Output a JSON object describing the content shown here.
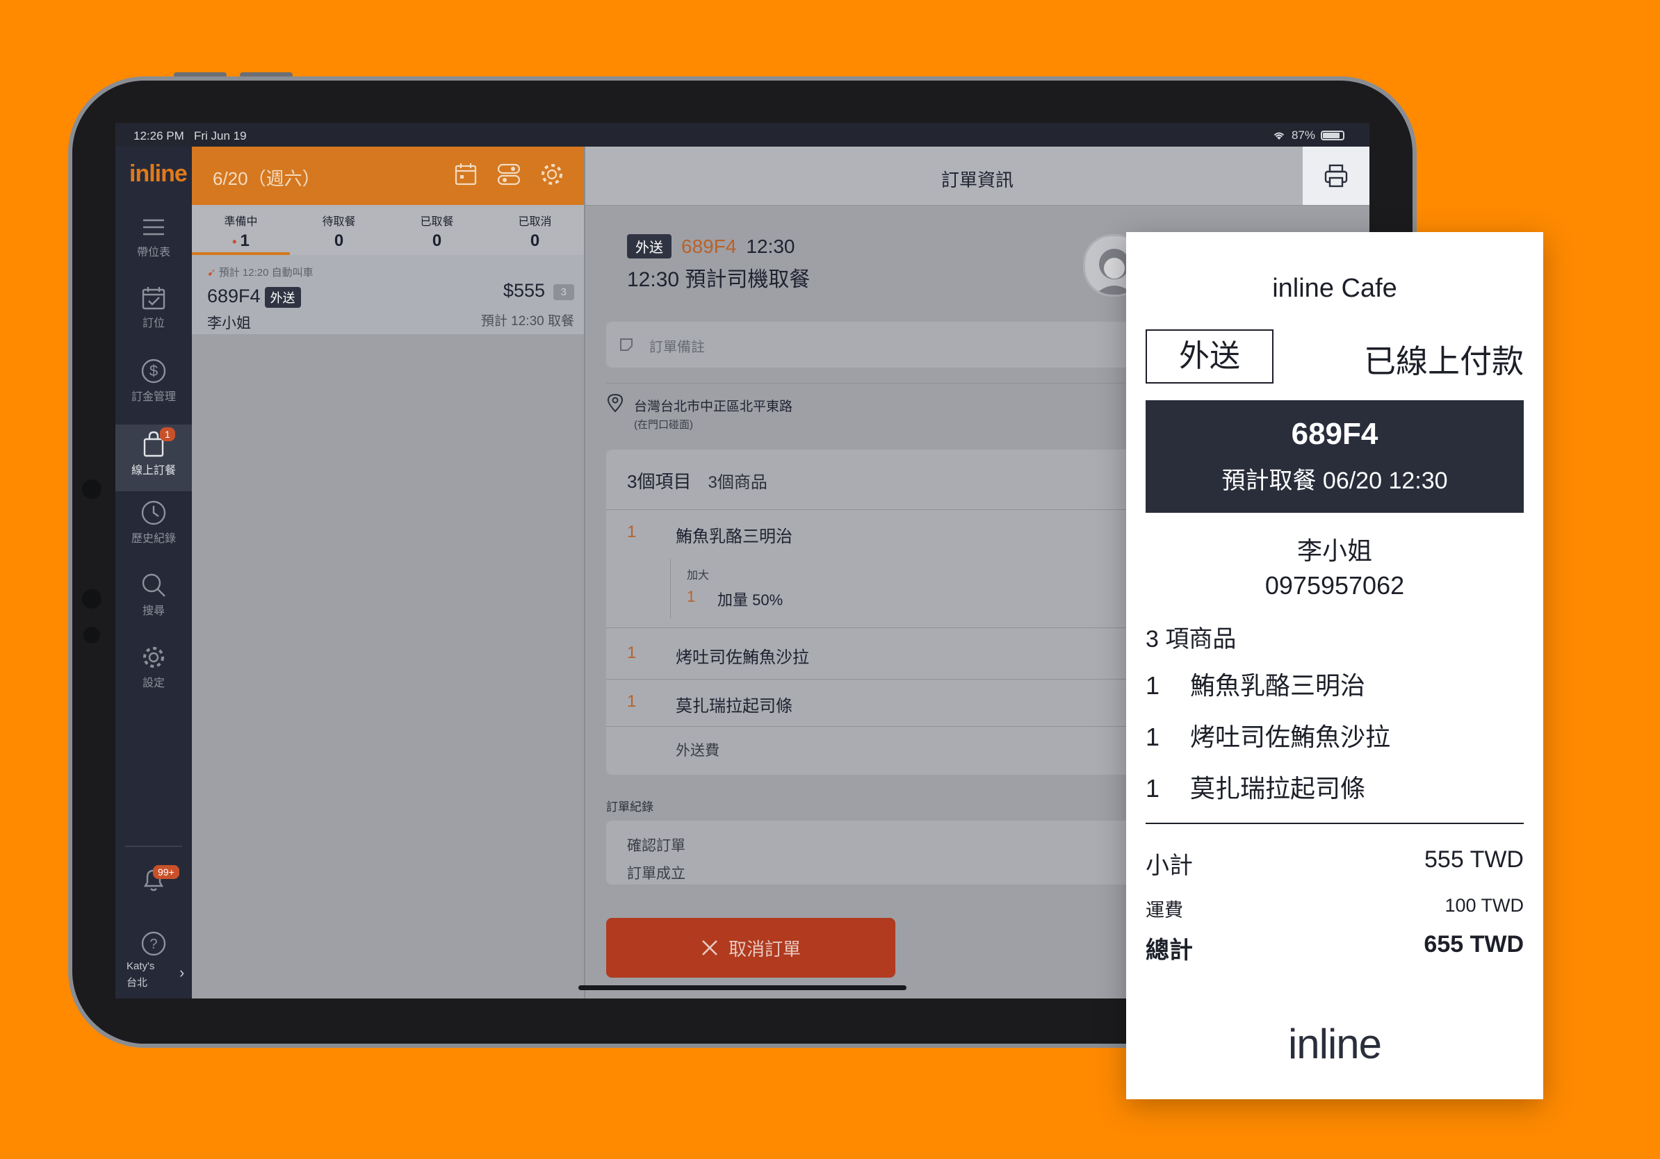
{
  "status": {
    "time": "12:26 PM",
    "date": "Fri Jun 19",
    "battery": "87%"
  },
  "sidebar": {
    "logo": "inline",
    "items": [
      {
        "label": "帶位表",
        "icon": "menu-icon"
      },
      {
        "label": "訂位",
        "icon": "calendar-check-icon"
      },
      {
        "label": "訂金管理",
        "icon": "dollar-icon"
      },
      {
        "label": "線上訂餐",
        "icon": "bag-icon",
        "badge": "1"
      },
      {
        "label": "歷史紀錄",
        "icon": "clock-icon"
      },
      {
        "label": "搜尋",
        "icon": "search-icon"
      },
      {
        "label": "設定",
        "icon": "gear-icon"
      }
    ],
    "notifications_badge": "99+",
    "account_line1": "Katy's",
    "account_line2": "台北"
  },
  "list": {
    "date": "6/20（週六）",
    "tabs": [
      {
        "name": "準備中",
        "value": "1"
      },
      {
        "name": "待取餐",
        "value": "0"
      },
      {
        "name": "已取餐",
        "value": "0"
      },
      {
        "name": "已取消",
        "value": "0"
      }
    ],
    "order": {
      "note": "預計 12:20 自動叫車",
      "code": "689F4",
      "type": "外送",
      "name": "李小姐",
      "price": "$555",
      "qty": "3",
      "eta": "預計 12:30 取餐"
    }
  },
  "detail": {
    "title": "訂單資訊",
    "type": "外送",
    "code": "689F4",
    "time": "12:30",
    "subtitle": "12:30 預計司機取餐",
    "note_placeholder": "訂單備註",
    "address": "台灣台北市中正區北平東路",
    "address_note": "(在門口碰面)",
    "items_header": "3個項目",
    "goods_count": "3個商品",
    "items": [
      {
        "qty": "1",
        "name": "鮪魚乳酪三明治"
      },
      {
        "qty": "1",
        "name": "烤吐司佐鮪魚沙拉"
      },
      {
        "qty": "1",
        "name": "莫扎瑞拉起司條"
      }
    ],
    "option_group": "加大",
    "option_qty": "1",
    "option_name": "加量 50%",
    "delivery_fee_label": "外送費",
    "log_title": "訂單紀錄",
    "log_entries": [
      "確認訂單",
      "訂單成立"
    ],
    "cancel_label": "取消訂單"
  },
  "receipt": {
    "shop": "inline Cafe",
    "type": "外送",
    "payment": "已線上付款",
    "code": "689F4",
    "pickup": "預計取餐 06/20 12:30",
    "name": "李小姐",
    "phone": "0975957062",
    "count": "3 項商品",
    "items": [
      {
        "qty": "1",
        "name": "鮪魚乳酪三明治"
      },
      {
        "qty": "1",
        "name": "烤吐司佐鮪魚沙拉"
      },
      {
        "qty": "1",
        "name": "莫扎瑞拉起司條"
      }
    ],
    "subtotal_label": "小計",
    "subtotal": "555 TWD",
    "shipping_label": "運費",
    "shipping": "100 TWD",
    "total_label": "總計",
    "total": "655 TWD",
    "brand": "inline"
  },
  "colors": {
    "background": "#FF8A00",
    "accent": "#D5781F",
    "danger": "#B13A1F",
    "sidebar": "#262A38"
  }
}
